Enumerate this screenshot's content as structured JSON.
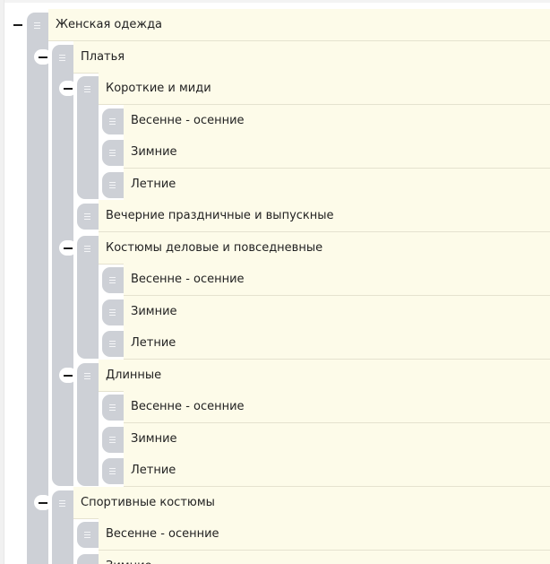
{
  "tree": {
    "items": [
      {
        "label": "Женская одежда",
        "level": 0,
        "expanded": true
      },
      {
        "label": "Платья",
        "level": 1,
        "expanded": true
      },
      {
        "label": "Короткие и миди",
        "level": 2,
        "expanded": true
      },
      {
        "label": "Весенне - осенние",
        "level": 3
      },
      {
        "label": "Зимние",
        "level": 3
      },
      {
        "label": "Летние",
        "level": 3
      },
      {
        "label": "Вечерние праздничные и выпускные",
        "level": 2
      },
      {
        "label": "Костюмы деловые и повседневные",
        "level": 2,
        "expanded": true
      },
      {
        "label": "Весенне - осенние",
        "level": 3
      },
      {
        "label": "Зимние",
        "level": 3
      },
      {
        "label": "Летние",
        "level": 3
      },
      {
        "label": "Длинные",
        "level": 2,
        "expanded": true
      },
      {
        "label": "Весенне - осенние",
        "level": 3
      },
      {
        "label": "Зимние",
        "level": 3
      },
      {
        "label": "Летние",
        "level": 3
      },
      {
        "label": "Спортивные костюмы",
        "level": 1,
        "expanded": true
      },
      {
        "label": "Весенне - осенние",
        "level": 2
      },
      {
        "label": "Зимние",
        "level": 2
      }
    ],
    "collapse_icon": "minus-icon",
    "drag_icon": "drag-handle-icon"
  }
}
